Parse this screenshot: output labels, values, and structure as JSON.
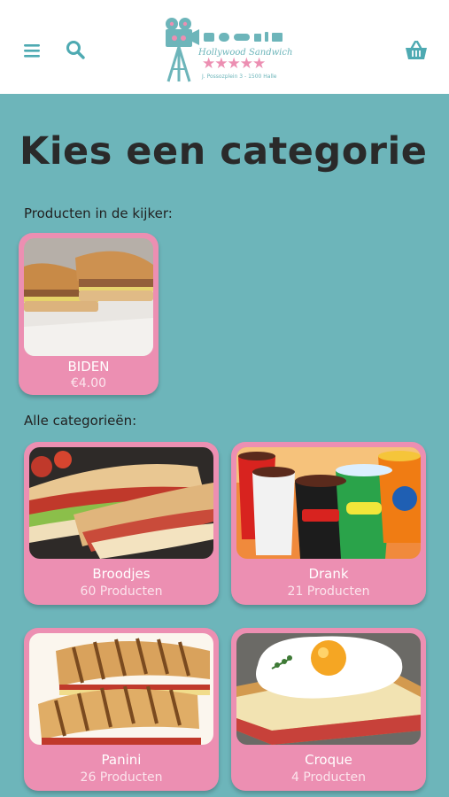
{
  "header": {
    "menu_icon": "hamburger-menu-icon",
    "search_icon": "search-icon",
    "basket_icon": "shopping-basket-icon",
    "logo": {
      "name": "Hollywood Sandwich",
      "address": "J. Possozplein 3 - 1500 Halle",
      "stars": "★★★★★"
    }
  },
  "main": {
    "title": "Kies een categorie",
    "featured_label": "Producten in de kijker:",
    "featured": [
      {
        "name": "BIDEN",
        "price": "€4.00"
      }
    ],
    "categories_label": "Alle categorieën:",
    "categories": [
      {
        "name": "Broodjes",
        "count": "60 Producten"
      },
      {
        "name": "Drank",
        "count": "21 Producten"
      },
      {
        "name": "Panini",
        "count": "26 Producten"
      },
      {
        "name": "Croque",
        "count": "4 Producten"
      }
    ]
  },
  "colors": {
    "background": "#6db5ba",
    "card": "#ec8fb2",
    "header": "#ffffff",
    "title": "#2a2a2a"
  }
}
